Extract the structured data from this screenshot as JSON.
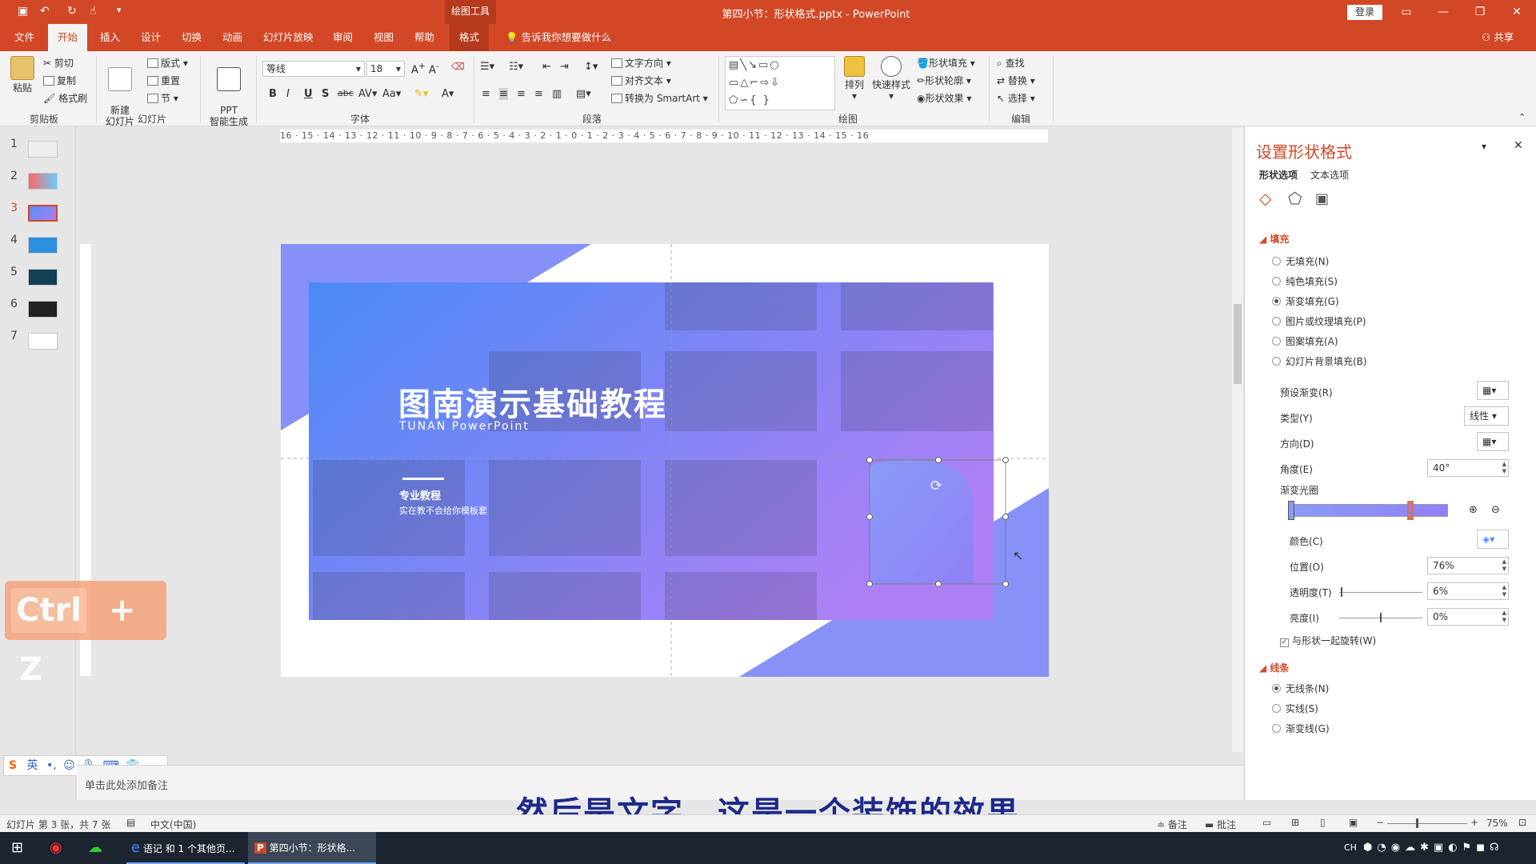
{
  "title_bar": {
    "context_tools": "绘图工具",
    "doc_title": "第四小节：形状格式.pptx - PowerPoint",
    "login": "登录"
  },
  "tabs": [
    "文件",
    "开始",
    "插入",
    "设计",
    "切换",
    "动画",
    "幻灯片放映",
    "审阅",
    "视图",
    "帮助",
    "格式"
  ],
  "active_tab": "开始",
  "tell_me": "告诉我你想要做什么",
  "share": "共享",
  "ribbon": {
    "clipboard": {
      "paste": "粘贴",
      "cut": "剪切",
      "copy": "复制",
      "format_painter": "格式刷",
      "label": "剪贴板"
    },
    "slides": {
      "new_slide": "新建\n幻灯片",
      "layout": "版式",
      "reset": "重置",
      "section": "节",
      "label": "幻灯片"
    },
    "ppt": {
      "btn": "PPT\n智能生成"
    },
    "font": {
      "name": "等线",
      "size": "18",
      "label": "字体"
    },
    "paragraph": {
      "text_direction": "文字方向",
      "align_text": "对齐文本",
      "smartart": "转换为 SmartArt",
      "label": "段落"
    },
    "drawing": {
      "arrange": "排列",
      "quick_styles": "快速样式",
      "shape_fill": "形状填充",
      "shape_outline": "形状轮廓",
      "shape_effects": "形状效果",
      "label": "绘图"
    },
    "editing": {
      "find": "查找",
      "replace": "替换",
      "select": "选择",
      "label": "编辑"
    }
  },
  "slides_panel": [
    "1",
    "2",
    "3",
    "4",
    "5",
    "6",
    "7"
  ],
  "active_slide": "3",
  "ruler_h": "16 · 15 · 14 · 13 · 12 · 11 · 10 · 9 · 8 · 7 · 6 · 5 · 4 · 3 · 2 · 1 · 0 · 1 · 2 · 3 · 4 · 5 · 6 · 7 · 8 · 9 · 10 · 11 · 12 · 13 · 14 · 15 · 16",
  "slide": {
    "title": "图南演示基础教程",
    "subtitle": "TUNAN PowerPoint",
    "tag": "专业教程",
    "desc": "实在教不会给你模板套"
  },
  "shortcut_overlay": {
    "key1": "Ctrl",
    "plus": "+",
    "key2": "Z"
  },
  "ime_toolbar": "英",
  "notes_placeholder": "单击此处添加备注",
  "caption": "然后是文字，这是一个装饰的效果",
  "format_pane": {
    "title": "设置形状格式",
    "tab_shape": "形状选项",
    "tab_text": "文本选项",
    "fill_section": "填充",
    "fill_options": [
      "无填充(N)",
      "纯色填充(S)",
      "渐变填充(G)",
      "图片或纹理填充(P)",
      "图案填充(A)",
      "幻灯片背景填充(B)"
    ],
    "fill_selected": "渐变填充(G)",
    "preset_gradient": "预设渐变(R)",
    "type_label": "类型(Y)",
    "type_value": "线性",
    "direction_label": "方向(D)",
    "angle_label": "角度(E)",
    "angle_value": "40°",
    "gradient_stops": "渐变光圈",
    "color_label": "颜色(C)",
    "position_label": "位置(O)",
    "position_value": "76%",
    "transparency_label": "透明度(T)",
    "transparency_value": "6%",
    "brightness_label": "亮度(I)",
    "brightness_value": "0%",
    "rotate_with_shape": "与形状一起旋转(W)",
    "line_section": "线条",
    "line_options": [
      "无线条(N)",
      "实线(S)",
      "渐变线(G)"
    ],
    "line_selected": "无线条(N)"
  },
  "status": {
    "slide_info": "幻灯片 第 3 张，共 7 张",
    "language": "中文(中国)",
    "notes": "备注",
    "comments": "批注",
    "zoom": "75%"
  },
  "taskbar": {
    "app1": "语记 和 1 个其他页...",
    "app2": "第四小节：形状格...",
    "ime": "CH"
  },
  "colors": {
    "accent": "#d24726",
    "gradient_start": "#4d8cf7",
    "gradient_end": "#a97ef6",
    "overlay": "#f6a27a"
  }
}
